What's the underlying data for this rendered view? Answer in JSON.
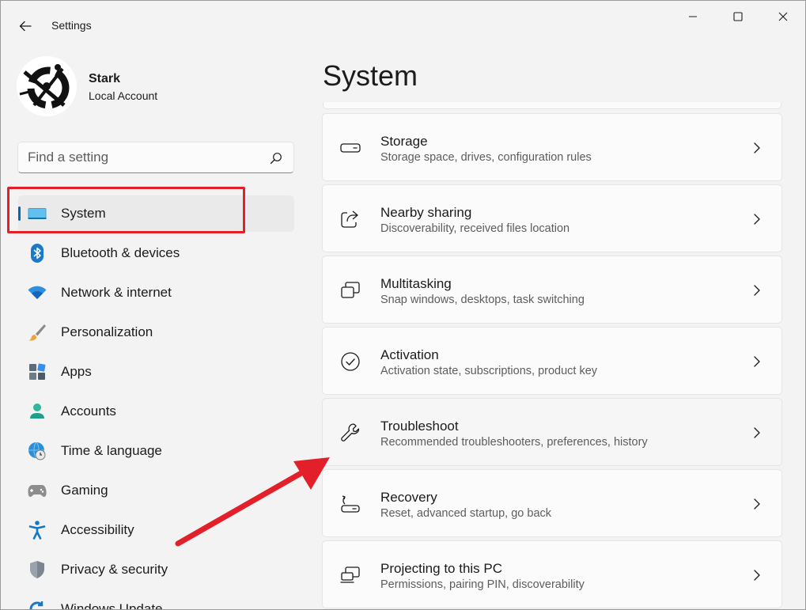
{
  "app": {
    "title": "Settings"
  },
  "profile": {
    "name": "Stark",
    "account_type": "Local Account"
  },
  "search": {
    "placeholder": "Find a setting"
  },
  "sidebar": {
    "items": [
      {
        "label": "System",
        "icon": "system-icon",
        "active": true
      },
      {
        "label": "Bluetooth & devices",
        "icon": "bluetooth-icon"
      },
      {
        "label": "Network & internet",
        "icon": "wifi-icon"
      },
      {
        "label": "Personalization",
        "icon": "brush-icon"
      },
      {
        "label": "Apps",
        "icon": "apps-icon"
      },
      {
        "label": "Accounts",
        "icon": "person-icon"
      },
      {
        "label": "Time & language",
        "icon": "globe-clock-icon"
      },
      {
        "label": "Gaming",
        "icon": "gamepad-icon"
      },
      {
        "label": "Accessibility",
        "icon": "accessibility-icon"
      },
      {
        "label": "Privacy & security",
        "icon": "shield-icon"
      },
      {
        "label": "Windows Update",
        "icon": "update-icon"
      }
    ]
  },
  "main": {
    "title": "System",
    "cards": [
      {
        "title": "Storage",
        "description": "Storage space, drives, configuration rules",
        "icon": "storage-icon"
      },
      {
        "title": "Nearby sharing",
        "description": "Discoverability, received files location",
        "icon": "share-icon"
      },
      {
        "title": "Multitasking",
        "description": "Snap windows, desktops, task switching",
        "icon": "multitasking-icon"
      },
      {
        "title": "Activation",
        "description": "Activation state, subscriptions, product key",
        "icon": "check-circle-icon"
      },
      {
        "title": "Troubleshoot",
        "description": "Recommended troubleshooters, preferences, history",
        "icon": "wrench-icon"
      },
      {
        "title": "Recovery",
        "description": "Reset, advanced startup, go back",
        "icon": "recovery-icon"
      },
      {
        "title": "Projecting to this PC",
        "description": "Permissions, pairing PIN, discoverability",
        "icon": "projecting-icon"
      }
    ]
  },
  "colors": {
    "accent": "#0067c0",
    "annotation_red": "#e3202a",
    "background": "#f3f3f3",
    "card": "#fbfbfb"
  }
}
